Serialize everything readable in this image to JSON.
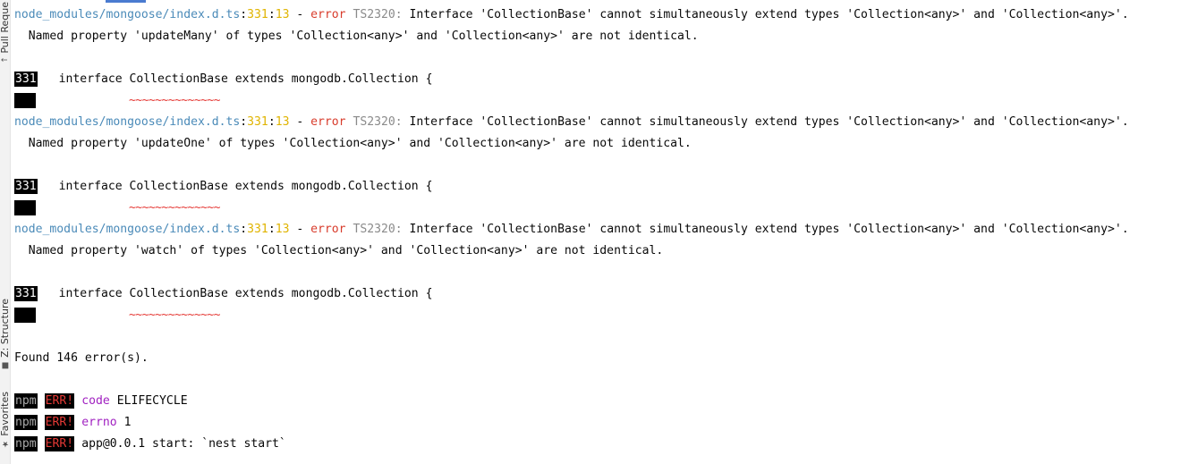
{
  "sidebar": {
    "tabs": [
      {
        "label": "Pull Reque",
        "icon": "arrow-icon"
      },
      {
        "label": "Z: Structure",
        "icon": "structure-icon"
      },
      {
        "label": "Favorites",
        "icon": "star-icon"
      }
    ]
  },
  "errors": [
    {
      "path": "node_modules/mongoose/index.d.ts",
      "sep1": ":",
      "line": "331",
      "sep2": ":",
      "col": "13",
      "dash": " - ",
      "level": "error",
      "code": " TS2320:",
      "message": " Interface 'CollectionBase' cannot simultaneously extend types 'Collection<any>' and 'Collection<any>'.",
      "detail": "  Named property 'updateMany' of types 'Collection<any>' and 'Collection<any>' are not identical.",
      "snippet_line": "331",
      "snippet_code": "interface CollectionBase extends mongodb.Collection {",
      "squiggle": "~~~~~~~~~~~~~~"
    },
    {
      "path": "node_modules/mongoose/index.d.ts",
      "sep1": ":",
      "line": "331",
      "sep2": ":",
      "col": "13",
      "dash": " - ",
      "level": "error",
      "code": " TS2320:",
      "message": " Interface 'CollectionBase' cannot simultaneously extend types 'Collection<any>' and 'Collection<any>'.",
      "detail": "  Named property 'updateOne' of types 'Collection<any>' and 'Collection<any>' are not identical.",
      "snippet_line": "331",
      "snippet_code": "interface CollectionBase extends mongodb.Collection {",
      "squiggle": "~~~~~~~~~~~~~~"
    },
    {
      "path": "node_modules/mongoose/index.d.ts",
      "sep1": ":",
      "line": "331",
      "sep2": ":",
      "col": "13",
      "dash": " - ",
      "level": "error",
      "code": " TS2320:",
      "message": " Interface 'CollectionBase' cannot simultaneously extend types 'Collection<any>' and 'Collection<any>'.",
      "detail": "  Named property 'watch' of types 'Collection<any>' and 'Collection<any>' are not identical.",
      "snippet_line": "331",
      "snippet_code": "interface CollectionBase extends mongodb.Collection {",
      "squiggle": "~~~~~~~~~~~~~~"
    }
  ],
  "summary": "Found 146 error(s).",
  "npm_lines": [
    {
      "prefix": "npm",
      "tag": "ERR!",
      "key": "code",
      "value": "ELIFECYCLE"
    },
    {
      "prefix": "npm",
      "tag": "ERR!",
      "key": "errno",
      "value": "1"
    },
    {
      "prefix": "npm",
      "tag": "ERR!",
      "key": "",
      "value": "app@0.0.1 start: `nest start`"
    }
  ]
}
